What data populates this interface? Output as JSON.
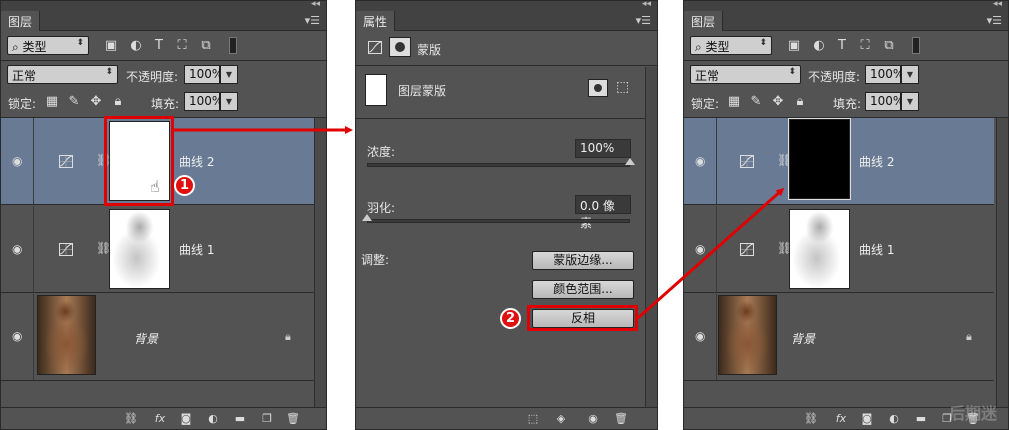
{
  "left_panel": {
    "tab": "图层",
    "filter_kind": "类型",
    "blend_mode": "正常",
    "opacity_label": "不透明度:",
    "opacity_value": "100%",
    "lock_label": "锁定:",
    "fill_label": "填充:",
    "fill_value": "100%",
    "layers": [
      {
        "name": "曲线 2"
      },
      {
        "name": "曲线 1"
      },
      {
        "name": "背景"
      }
    ]
  },
  "middle_panel": {
    "tab": "属性",
    "mode_label": "蒙版",
    "mask_type": "图层蒙版",
    "density_label": "浓度:",
    "density_value": "100%",
    "density_level": 1.0,
    "feather_label": "羽化:",
    "feather_value": "0.0 像素",
    "feather_level": 0.0,
    "adjust_label": "调整:",
    "btn_mask_edge": "蒙版边缘...",
    "btn_color_range": "颜色范围...",
    "btn_invert": "反相"
  },
  "right_panel": {
    "tab": "图层",
    "filter_kind": "类型",
    "blend_mode": "正常",
    "opacity_label": "不透明度:",
    "opacity_value": "100%",
    "lock_label": "锁定:",
    "fill_label": "填充:",
    "fill_value": "100%",
    "layers": [
      {
        "name": "曲线 2"
      },
      {
        "name": "曲线 1"
      },
      {
        "name": "背景"
      }
    ]
  },
  "annotations": {
    "step1": "1",
    "step2": "2"
  },
  "colors": {
    "panel_bg": "#535353",
    "selected_layer": "#687a94",
    "annotation_red": "#e00000"
  }
}
